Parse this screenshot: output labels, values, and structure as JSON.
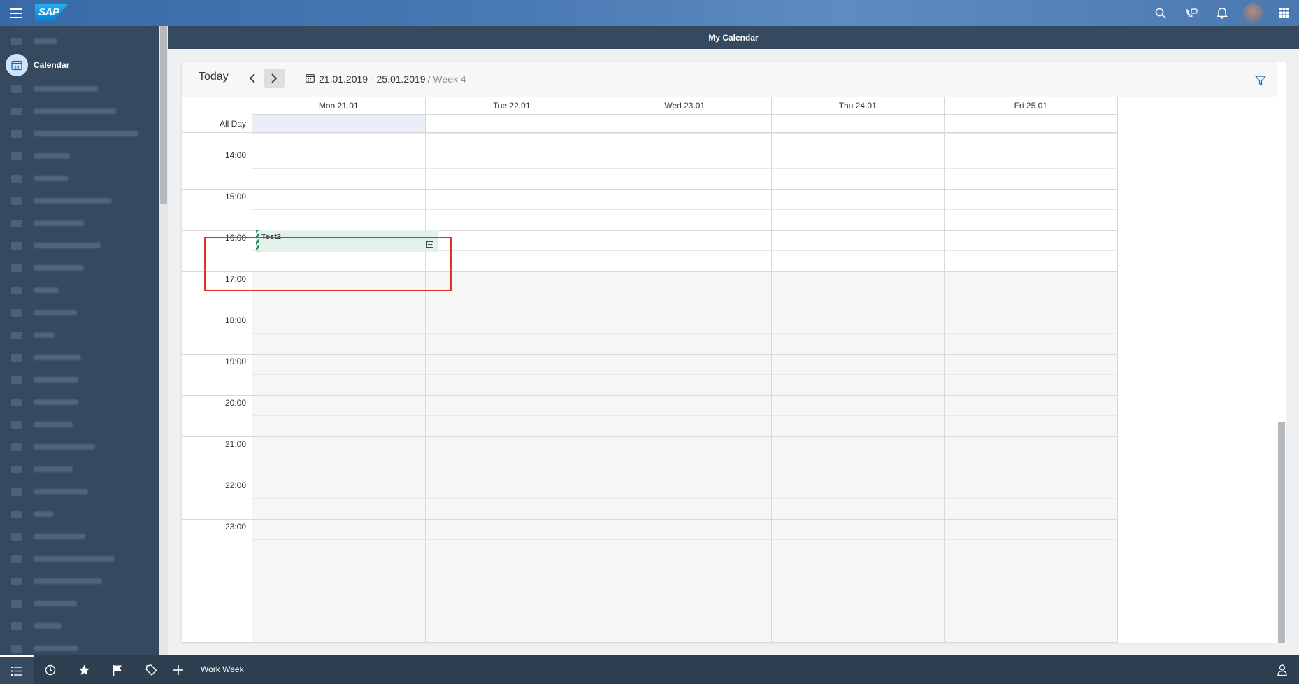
{
  "header": {
    "logo": "SAP",
    "icons": [
      "search-icon",
      "phone-chat-icon",
      "bell-icon",
      "avatar",
      "app-grid-icon"
    ]
  },
  "nav": {
    "active_label": "Calendar",
    "active_icon_text": "14",
    "blurred_items": 27
  },
  "page": {
    "title": "My Calendar"
  },
  "toolbar": {
    "today": "Today",
    "date_range": "21.01.2019 - 25.01.2019",
    "week": "/ Week 4"
  },
  "calendar": {
    "columns": [
      "Mon 21.01",
      "Tue 22.01",
      "Wed 23.01",
      "Thu 24.01",
      "Fri 25.01"
    ],
    "all_day_label": "All Day",
    "hours": [
      "14:00",
      "15:00",
      "16:00",
      "17:00",
      "18:00",
      "19:00",
      "20:00",
      "21:00",
      "22:00",
      "23:00"
    ],
    "appointment": {
      "title": "Test2",
      "day": "Mon 21.01",
      "start": "16:00",
      "color": "#e4f1ea"
    }
  },
  "bottom_bar": {
    "label": "Work Week",
    "tabs": [
      "list-icon",
      "clock-icon",
      "star-icon",
      "flag-icon",
      "tag-icon"
    ]
  },
  "colors": {
    "shell": "#354a5f",
    "accent": "#0a6ed1",
    "highlight": "#e03131"
  }
}
